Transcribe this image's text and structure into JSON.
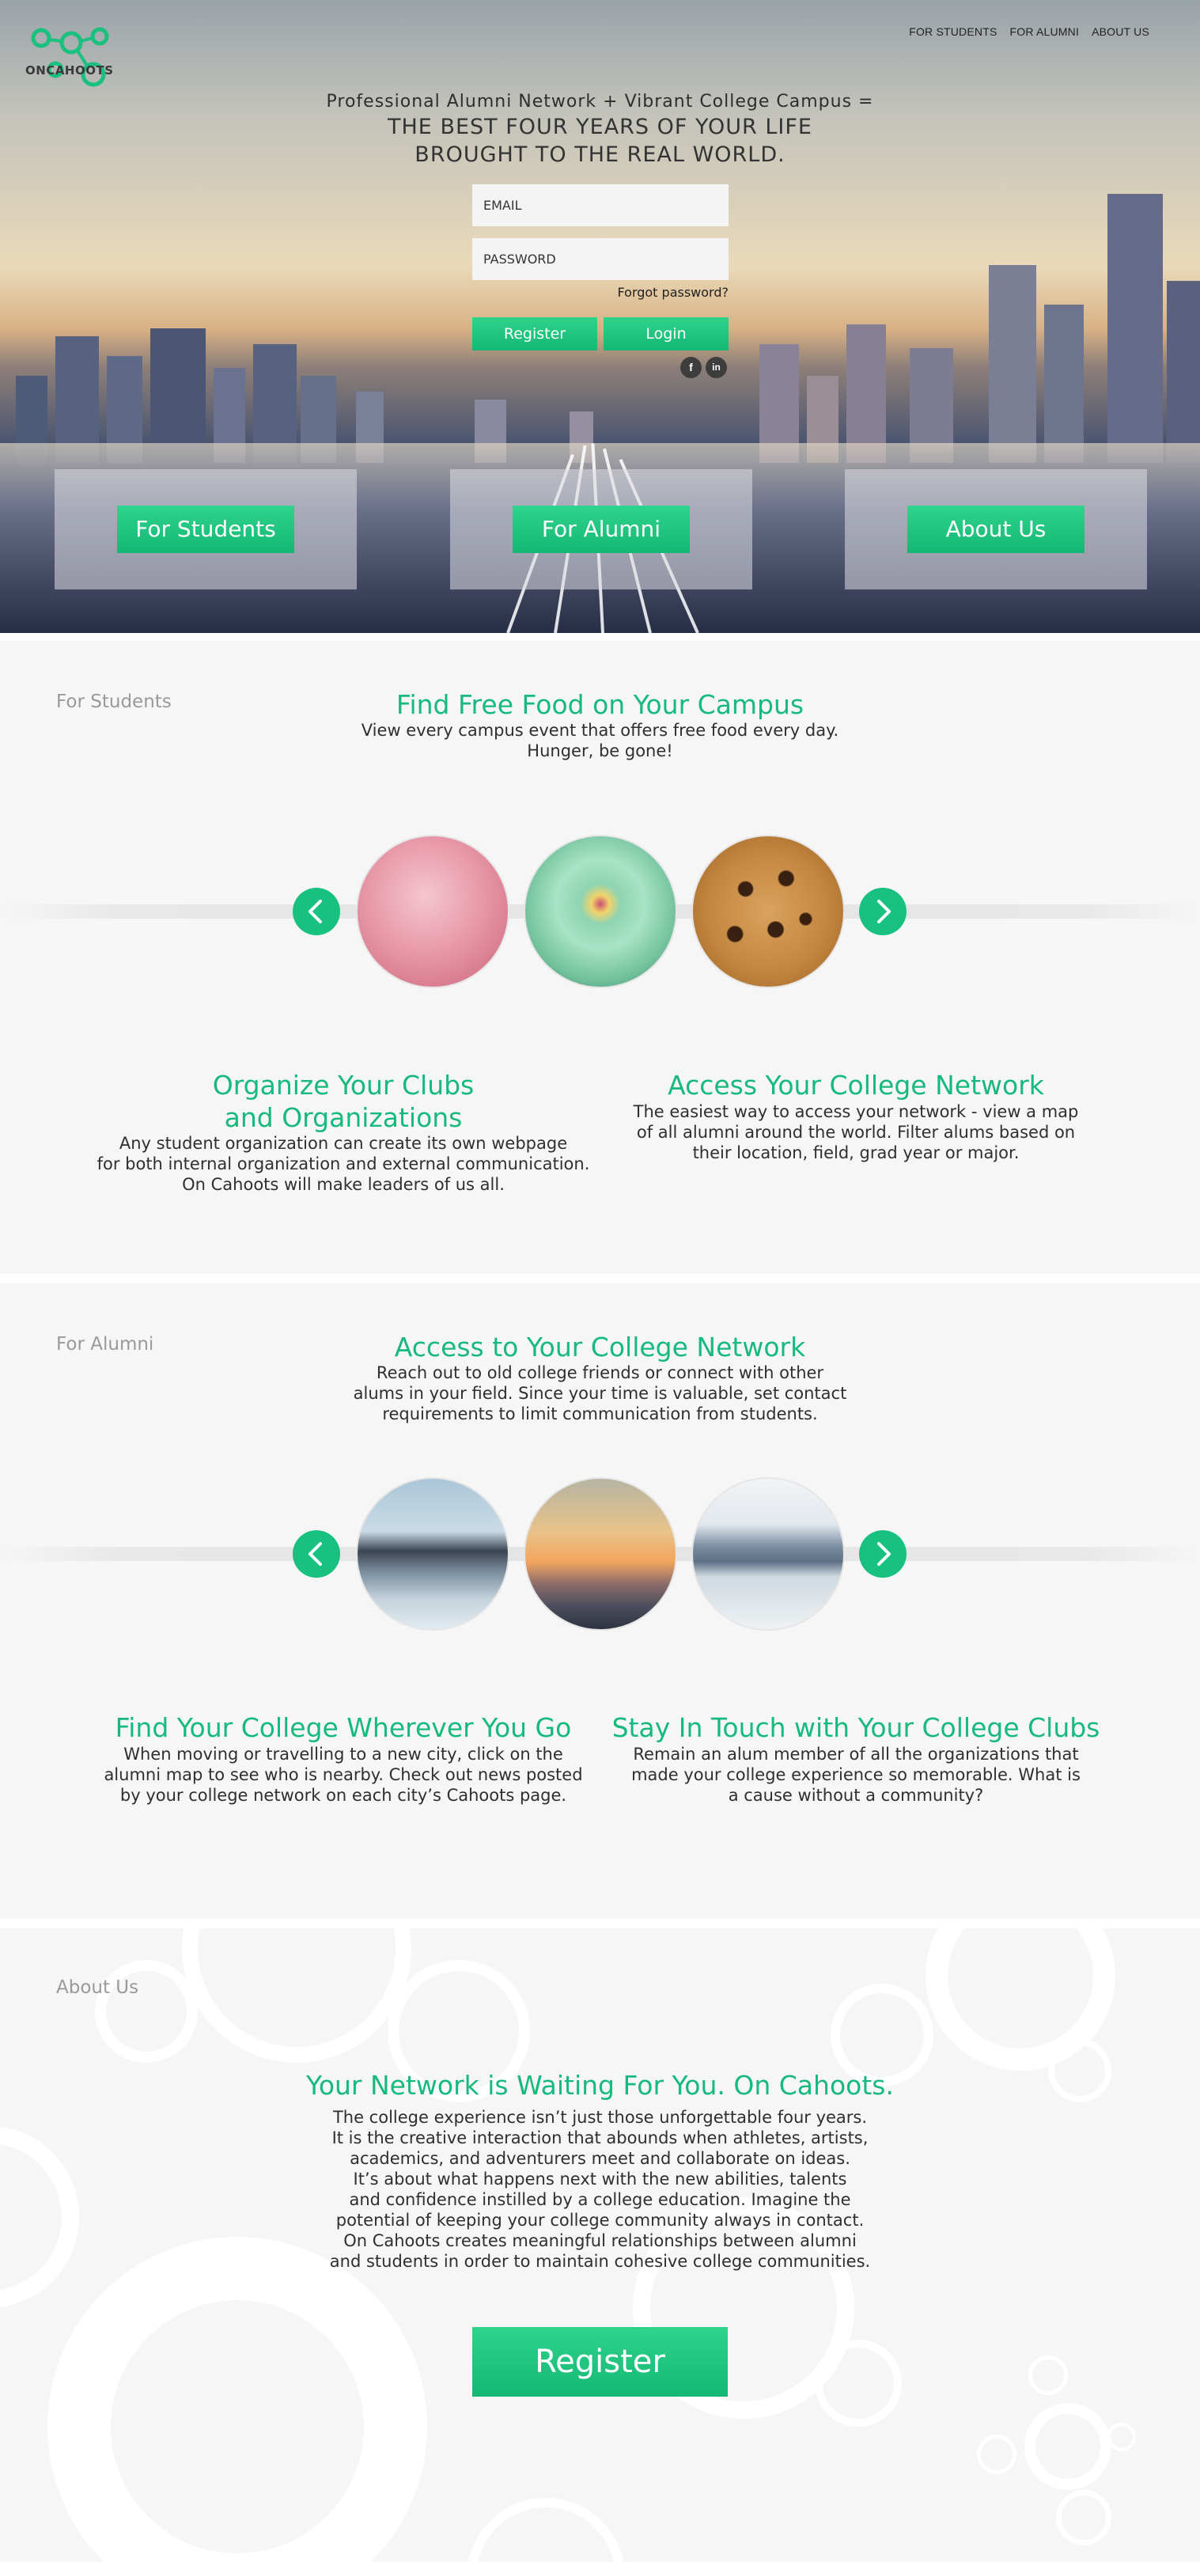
{
  "logo": {
    "text": "ONCAHOOTS",
    "icon": "connected-rings-logo"
  },
  "nav": {
    "items": [
      "FOR STUDENTS",
      "FOR ALUMNI",
      "ABOUT US"
    ]
  },
  "hero": {
    "tagline": "Professional Alumni Network + Vibrant College Campus =",
    "headline_line1": "THE BEST FOUR YEARS OF YOUR LIFE",
    "headline_line2": "BROUGHT TO THE REAL WORLD.",
    "email_placeholder": "EMAIL",
    "password_placeholder": "PASSWORD",
    "forgot_password": "Forgot password?",
    "register_label": "Register",
    "login_label": "Login",
    "social": [
      {
        "icon": "facebook-icon",
        "glyph": "f"
      },
      {
        "icon": "linkedin-icon",
        "glyph": "in"
      }
    ],
    "panels": [
      "For Students",
      "For Alumni",
      "About Us"
    ]
  },
  "students": {
    "label": "For Students",
    "feature_title": "Find Free Food on Your Campus",
    "feature_body_line1": "View every campus event that offers free food every day.",
    "feature_body_line2": "Hunger, be gone!",
    "carousel": [
      "strawberry-ice-cream-photo",
      "cupcake-photo",
      "chocolate-chip-cookie-photo"
    ],
    "left": {
      "title_line1": "Organize Your Clubs",
      "title_line2": "and Organizations",
      "body_lines": [
        "Any student organization can create its own webpage",
        "for both internal organization and external communication.",
        "On Cahoots will make leaders of us all."
      ]
    },
    "right": {
      "title": "Access Your College Network",
      "body_lines": [
        "The easiest way to access your network - view a map",
        "of all alumni around the world. Filter alums based on",
        "their location, field, grad year or major."
      ]
    }
  },
  "alumni": {
    "label": "For Alumni",
    "feature_title": "Access to Your College Network",
    "feature_body_lines": [
      "Reach out to old college friends or connect with other",
      "alums in your field. Since your time is valuable, set contact",
      "requirements to limit communication from students."
    ],
    "carousel": [
      "chicago-skyline-photo",
      "sunset-city-photo",
      "new-york-skyline-photo"
    ],
    "left": {
      "title": "Find Your College Wherever You Go",
      "body_lines": [
        "When moving or travelling to a new city, click on the",
        "alumni map to see who is nearby. Check out news posted",
        "by your college network on each city’s Cahoots page."
      ]
    },
    "right": {
      "title": "Stay In Touch with Your College Clubs",
      "body_lines": [
        "Remain an alum member of all the organizations that",
        "made your college experience so memorable. What is",
        "a cause without a community?"
      ]
    }
  },
  "about": {
    "label": "About Us",
    "title": "Your Network is Waiting For You. On Cahoots.",
    "body_lines": [
      "The college experience isn’t just those unforgettable four years.",
      "It is the creative interaction that abounds when athletes, artists,",
      "academics, and adventurers meet and collaborate on ideas.",
      "It’s about what happens next with the new abilities, talents",
      "and confidence instilled by a college education. Imagine the",
      "potential of keeping your college community always in contact.",
      "On Cahoots creates meaningful relationships between alumni",
      "and students in order to maintain cohesive college communities."
    ],
    "register_label": "Register"
  },
  "colors": {
    "accent": "#16b97e",
    "button": "#1ec47f",
    "section_bg": "#f6f6f6",
    "label_gray": "#9a9a9a"
  }
}
